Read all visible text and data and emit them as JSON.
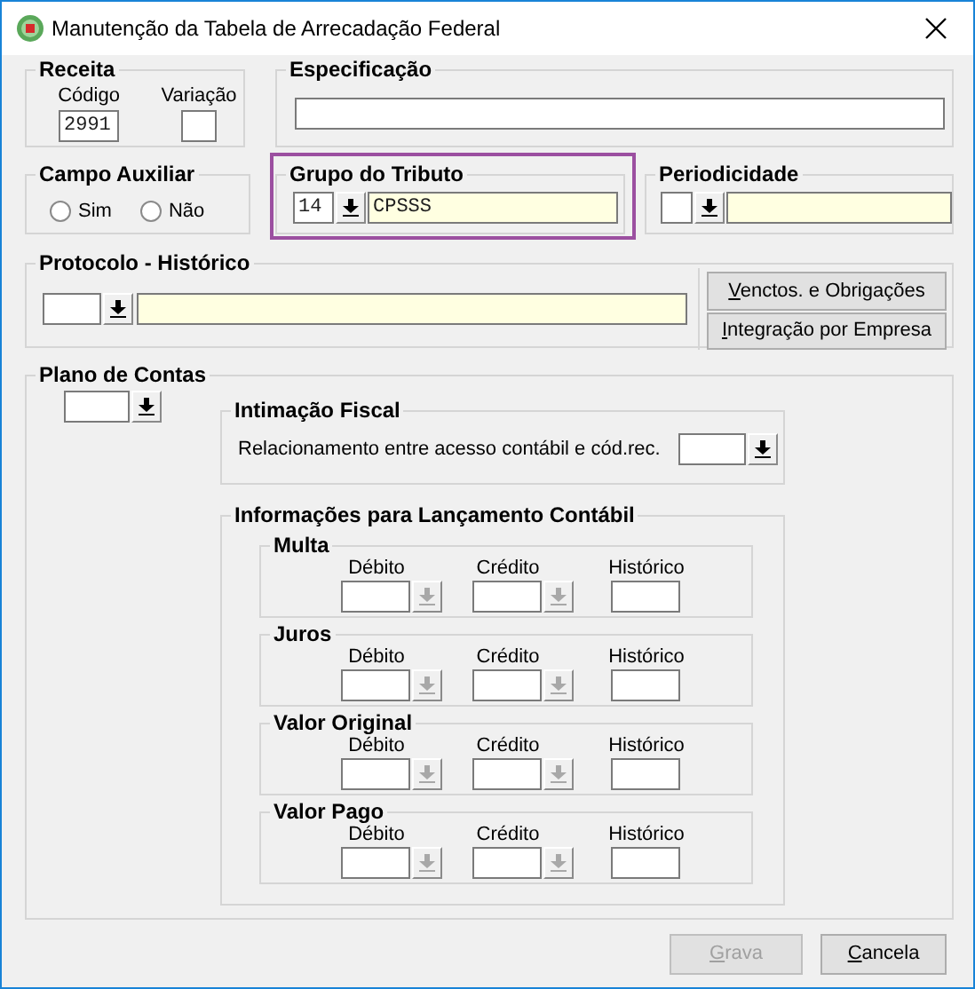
{
  "window": {
    "title": "Manutenção da Tabela de Arrecadação Federal"
  },
  "receita": {
    "title": "Receita",
    "codigo": {
      "label": "Código",
      "value": "2991"
    },
    "variacao": {
      "label": "Variação"
    }
  },
  "especificacao": {
    "title": "Especificação"
  },
  "campo_auxiliar": {
    "title": "Campo Auxiliar",
    "options": [
      {
        "label": "Sim",
        "selected": false
      },
      {
        "label": "Não",
        "selected": false
      }
    ]
  },
  "grupo_do_tributo": {
    "title": "Grupo do Tributo",
    "highlighted": true,
    "code": "14",
    "description": "CPSSS"
  },
  "periodicidade": {
    "title": "Periodicidade"
  },
  "protocolo_historico": {
    "title": "Protocolo - Histórico",
    "buttons": [
      {
        "label": "Venctos. e Obrigações",
        "disabled": false
      },
      {
        "label": "Integração por Empresa",
        "disabled": false
      }
    ]
  },
  "plano_de_contas": {
    "title": "Plano de Contas",
    "intimacao_fiscal": {
      "title": "Intimação Fiscal",
      "label": "Relacionamento entre acesso contábil e cód.rec."
    },
    "informacoes": {
      "title": "Informações para Lançamento Contábil",
      "groups": [
        {
          "title": "Multa",
          "columns": [
            {
              "label": "Débito",
              "kind": "lookup",
              "disabled": true
            },
            {
              "label": "Crédito",
              "kind": "lookup",
              "disabled": true
            },
            {
              "label": "Histórico",
              "kind": "field"
            }
          ]
        },
        {
          "title": "Juros",
          "columns": [
            {
              "label": "Débito",
              "kind": "lookup",
              "disabled": true
            },
            {
              "label": "Crédito",
              "kind": "lookup",
              "disabled": true
            },
            {
              "label": "Histórico",
              "kind": "field"
            }
          ]
        },
        {
          "title": "Valor Original",
          "columns": [
            {
              "label": "Débito",
              "kind": "lookup",
              "disabled": true
            },
            {
              "label": "Crédito",
              "kind": "lookup",
              "disabled": true
            },
            {
              "label": "Histórico",
              "kind": "field"
            }
          ]
        },
        {
          "title": "Valor Pago",
          "columns": [
            {
              "label": "Débito",
              "kind": "lookup",
              "disabled": true
            },
            {
              "label": "Crédito",
              "kind": "lookup",
              "disabled": true
            },
            {
              "label": "Histórico",
              "kind": "field"
            }
          ]
        }
      ]
    }
  },
  "buttons": [
    {
      "label": "Grava",
      "disabled": true
    },
    {
      "label": "Cancela",
      "disabled": false
    }
  ]
}
